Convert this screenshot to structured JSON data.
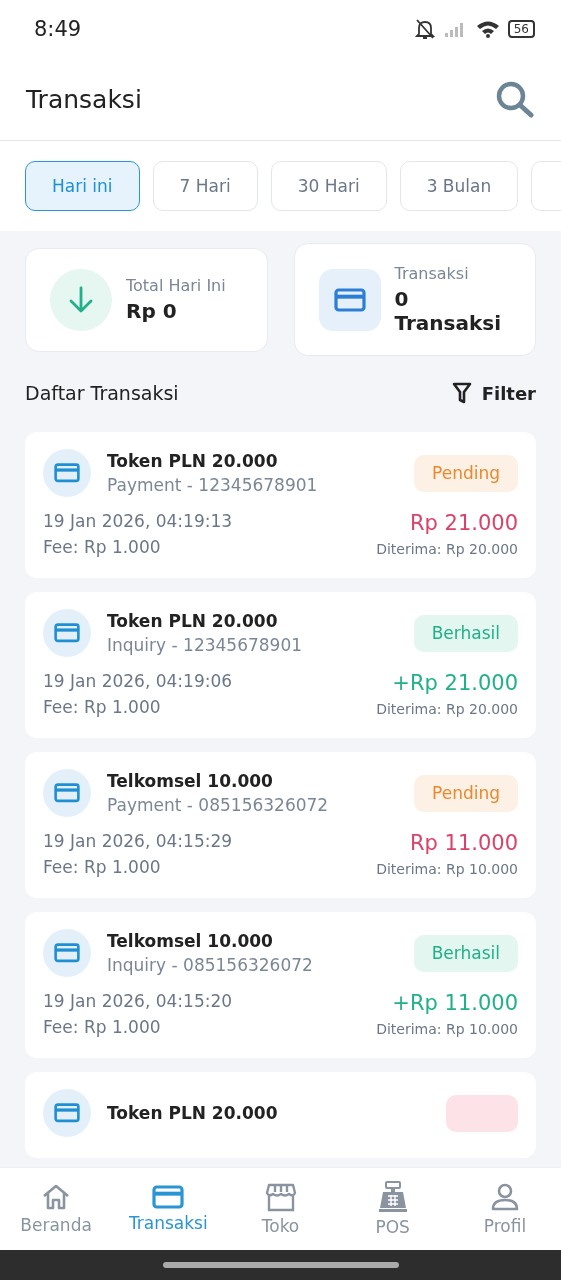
{
  "status_bar": {
    "time": "8:49",
    "battery": "56"
  },
  "header": {
    "title": "Transaksi"
  },
  "chips": [
    {
      "label": "Hari ini",
      "selected": true
    },
    {
      "label": "7 Hari",
      "selected": false
    },
    {
      "label": "30 Hari",
      "selected": false
    },
    {
      "label": "3 Bulan",
      "selected": false
    },
    {
      "selected": false
    }
  ],
  "stats": [
    {
      "kind": "income",
      "label": "Total Hari Ini",
      "value": "Rp 0"
    },
    {
      "kind": "count",
      "label": "Transaksi",
      "value": "0 Transaksi"
    }
  ],
  "list_title": "Daftar Transaksi",
  "filter_label": "Filter",
  "transactions": [
    {
      "title": "Token PLN 20.000",
      "subtitle": "Payment - 12345678901",
      "kind": "pending",
      "status_label": "Pending",
      "date": "19 Jan 2026, 04:19:13",
      "fee": "Fee: Rp 1.000",
      "amount": "Rp 21.000",
      "received": "Diterima: Rp 20.000"
    },
    {
      "title": "Token PLN 20.000",
      "subtitle": "Inquiry - 12345678901",
      "kind": "success",
      "status_label": "Berhasil",
      "date": "19 Jan 2026, 04:19:06",
      "fee": "Fee: Rp 1.000",
      "amount": "+Rp 21.000",
      "received": "Diterima: Rp 20.000"
    },
    {
      "title": "Telkomsel 10.000",
      "subtitle": "Payment - 085156326072",
      "kind": "pending",
      "status_label": "Pending",
      "date": "19 Jan 2026, 04:15:29",
      "fee": "Fee: Rp 1.000",
      "amount": "Rp 11.000",
      "received": "Diterima: Rp 10.000"
    },
    {
      "title": "Telkomsel 10.000",
      "subtitle": "Inquiry - 085156326072",
      "kind": "success",
      "status_label": "Berhasil",
      "date": "19 Jan 2026, 04:15:20",
      "fee": "Fee: Rp 1.000",
      "amount": "+Rp 11.000",
      "received": "Diterima: Rp 10.000"
    },
    {
      "title": "Token PLN 20.000",
      "kind": "failed"
    }
  ],
  "nav": [
    {
      "kind": "home",
      "label": "Beranda",
      "selected": false
    },
    {
      "kind": "card",
      "label": "Transaksi",
      "selected": true
    },
    {
      "kind": "store",
      "label": "Toko",
      "selected": false
    },
    {
      "kind": "register",
      "label": "POS",
      "selected": false
    },
    {
      "kind": "user",
      "label": "Profil",
      "selected": false
    }
  ]
}
